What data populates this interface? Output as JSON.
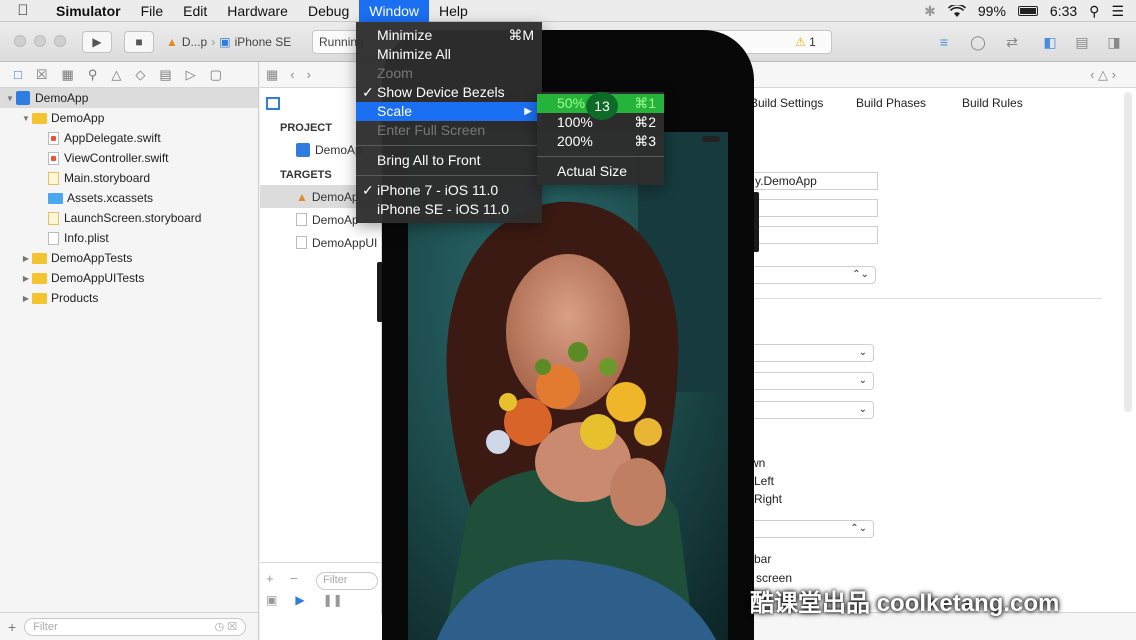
{
  "menubar": {
    "app_name": "Simulator",
    "menus": [
      "File",
      "Edit",
      "Hardware",
      "Debug",
      "Window",
      "Help"
    ],
    "battery_percent": "99%",
    "time": "6:33"
  },
  "toolbar": {
    "scheme_target": "D...p",
    "scheme_device": "iPhone SE",
    "status_text": "Running",
    "warning_count": "1"
  },
  "navigator": {
    "items": [
      {
        "label": "DemoApp",
        "kind": "project",
        "level": 0,
        "open": true
      },
      {
        "label": "DemoApp",
        "kind": "folder",
        "level": 1,
        "open": true
      },
      {
        "label": "AppDelegate.swift",
        "kind": "swift",
        "level": 2
      },
      {
        "label": "ViewController.swift",
        "kind": "swift",
        "level": 2
      },
      {
        "label": "Main.storyboard",
        "kind": "storyboard",
        "level": 2
      },
      {
        "label": "Assets.xcassets",
        "kind": "assets",
        "level": 2
      },
      {
        "label": "LaunchScreen.storyboard",
        "kind": "storyboard",
        "level": 2
      },
      {
        "label": "Info.plist",
        "kind": "plist",
        "level": 2
      },
      {
        "label": "DemoAppTests",
        "kind": "folder",
        "level": 1,
        "open": false
      },
      {
        "label": "DemoAppUITests",
        "kind": "folder",
        "level": 1,
        "open": false
      },
      {
        "label": "Products",
        "kind": "folder",
        "level": 1,
        "open": false
      }
    ],
    "filter_placeholder": "Filter"
  },
  "editor": {
    "project_header": "PROJECT",
    "project_item": "DemoAp",
    "targets_header": "TARGETS",
    "targets": [
      "DemoAp",
      "DemoAp",
      "DemoAppUI"
    ],
    "tabs": [
      "Build Settings",
      "Build Phases",
      "Build Rules"
    ],
    "bundle_id": "y.DemoApp",
    "labels": [
      "wn",
      "Left",
      "Right",
      "bar",
      "l screen"
    ],
    "filter_placeholder": "Filter"
  },
  "window_menu": {
    "items": [
      {
        "label": "Minimize",
        "shortcut": "⌘M"
      },
      {
        "label": "Minimize All"
      },
      {
        "label": "Zoom",
        "disabled": true
      },
      {
        "label": "Show Device Bezels",
        "checked": true
      },
      {
        "label": "Scale",
        "submenu": true,
        "highlighted": true
      },
      {
        "label": "Enter Full Screen",
        "disabled": true
      },
      {
        "divider": true
      },
      {
        "label": "Bring All to Front"
      },
      {
        "divider": true
      },
      {
        "label": "iPhone 7 - iOS 11.0",
        "checked": true
      },
      {
        "label": "iPhone SE - iOS 11.0"
      }
    ]
  },
  "scale_submenu": {
    "items": [
      {
        "label": "50%",
        "shortcut": "⌘1",
        "highlighted": true
      },
      {
        "label": "100%",
        "shortcut": "⌘2"
      },
      {
        "label": "200%",
        "shortcut": "⌘3"
      },
      {
        "divider": true
      },
      {
        "label": "Actual Size"
      }
    ]
  },
  "step_badge": "13",
  "watermark": "酷课堂出品 coolketang.com",
  "colors": {
    "menu_highlight": "#1b6ff2",
    "submenu_highlight": "#25b33b",
    "menu_bg": "#2e2e2e",
    "folder": "#f4c430"
  }
}
